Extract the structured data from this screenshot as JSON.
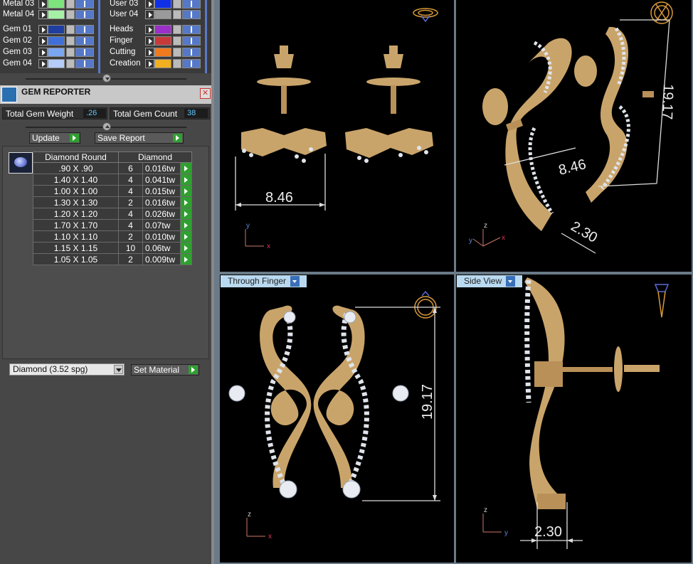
{
  "layers": {
    "left": [
      {
        "name": "Metal 03",
        "color": "#7de37d"
      },
      {
        "name": "Metal 04",
        "color": "#a6f0a6"
      },
      {
        "name": "Gem 01",
        "color": "#1f3fa0"
      },
      {
        "name": "Gem 02",
        "color": "#3f6fd8"
      },
      {
        "name": "Gem 03",
        "color": "#7aa6f0"
      },
      {
        "name": "Gem 04",
        "color": "#b4ccf7"
      }
    ],
    "right": [
      {
        "name": "User 03",
        "color": "#1030e8"
      },
      {
        "name": "User 04",
        "color": "#9a9a9a"
      },
      {
        "name": "Heads",
        "color": "#9b2fc8"
      },
      {
        "name": "Finger",
        "color": "#c83a3a"
      },
      {
        "name": "Cutting",
        "color": "#f07a1e"
      },
      {
        "name": "Creation",
        "color": "#f0b020"
      }
    ]
  },
  "gem_reporter": {
    "title": "GEM REPORTER",
    "close": "✕",
    "total_weight_label": "Total Gem Weight",
    "total_weight": ".26",
    "total_count_label": "Total Gem Count",
    "total_count": "38",
    "update_label": "Update",
    "save_label": "Save Report",
    "col_shape": "Diamond Round",
    "col_material": "Diamond",
    "rows": [
      {
        "size": ".90 X .90",
        "count": "6",
        "tw": "0.016tw"
      },
      {
        "size": "1.40 X 1.40",
        "count": "4",
        "tw": "0.041tw"
      },
      {
        "size": "1.00 X 1.00",
        "count": "4",
        "tw": "0.015tw"
      },
      {
        "size": "1.30 X 1.30",
        "count": "2",
        "tw": "0.016tw"
      },
      {
        "size": "1.20 X 1.20",
        "count": "4",
        "tw": "0.026tw"
      },
      {
        "size": "1.70 X 1.70",
        "count": "4",
        "tw": "0.07tw"
      },
      {
        "size": "1.10 X 1.10",
        "count": "2",
        "tw": "0.010tw"
      },
      {
        "size": "1.15 X 1.15",
        "count": "10",
        "tw": "0.06tw"
      },
      {
        "size": "1.05 X 1.05",
        "count": "2",
        "tw": "0.009tw"
      }
    ],
    "material_select": "Diamond     (3.52 spg)",
    "set_material_label": "Set Material"
  },
  "viewports": {
    "top_left": {
      "dim": "8.46",
      "axis_a": "y",
      "axis_b": "x"
    },
    "top_right": {
      "dim_height": "19.17",
      "dim_width": "8.46",
      "dim_depth": "2.30",
      "axis_a": "z",
      "axis_b": "x",
      "axis_c": "y"
    },
    "bottom_left": {
      "label": "Through Finger",
      "dim": "19.17",
      "axis_a": "z",
      "axis_b": "x"
    },
    "bottom_right": {
      "label": "Side View",
      "dim": "2.30",
      "axis_a": "z",
      "axis_b": "y"
    }
  }
}
